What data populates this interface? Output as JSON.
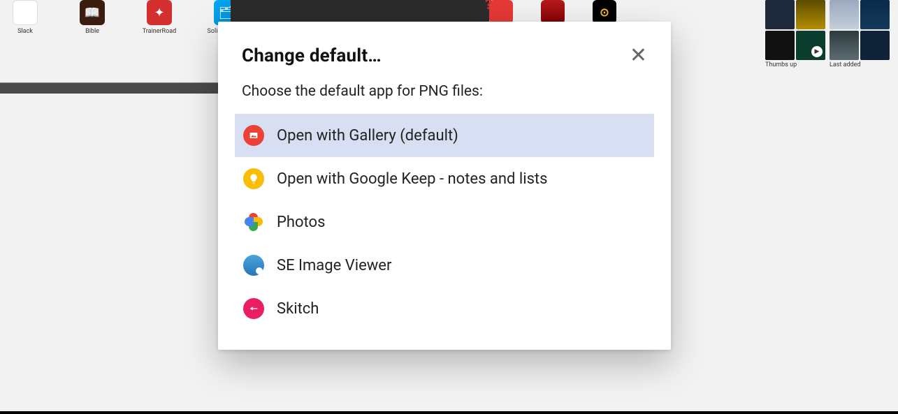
{
  "desktop": {
    "apps": [
      {
        "label": "Slack"
      },
      {
        "label": "Bible"
      },
      {
        "label": "TrainerRoad"
      },
      {
        "label": "Solid Explorer"
      }
    ]
  },
  "albums": {
    "left_caption": "Thumbs up",
    "right_caption": "Last added"
  },
  "dialog": {
    "title": "Change default…",
    "subtitle": "Choose the default app for PNG files:",
    "options": [
      {
        "label": "Open with Gallery (default)",
        "selected": true
      },
      {
        "label": "Open with Google Keep - notes and lists",
        "selected": false
      },
      {
        "label": "Photos",
        "selected": false
      },
      {
        "label": "SE Image Viewer",
        "selected": false
      },
      {
        "label": "Skitch",
        "selected": false
      }
    ]
  }
}
